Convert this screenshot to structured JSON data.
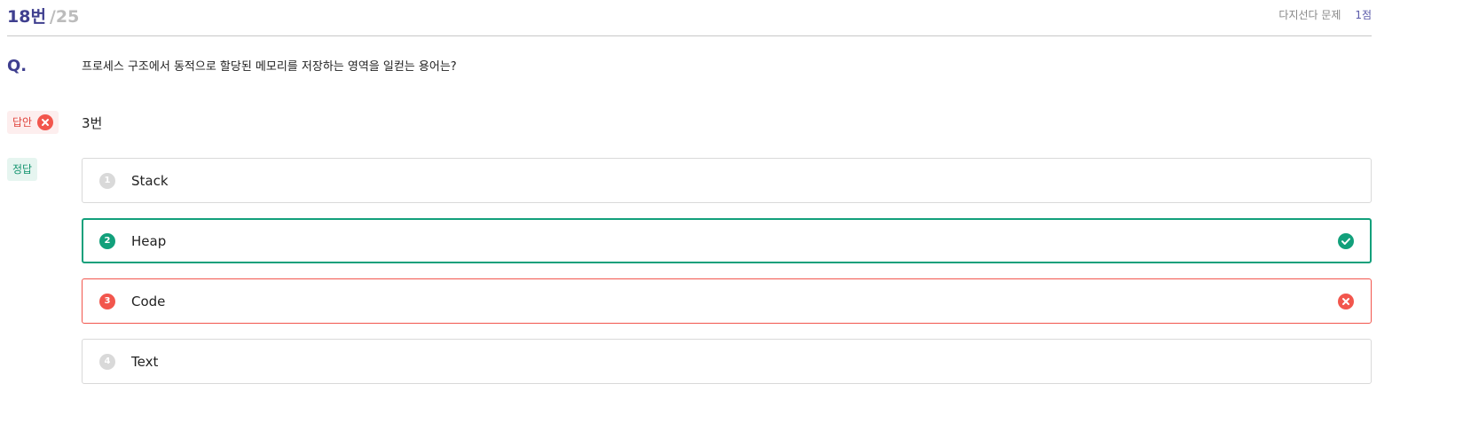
{
  "header": {
    "question_number": "18번",
    "question_total": "/25",
    "question_type": "다지선다 문제",
    "score": "1점"
  },
  "question": {
    "label": "Q.",
    "text": "프로세스 구조에서 동적으로 할당된 메모리를 저장하는 영역을 일컫는 용어는?"
  },
  "answer": {
    "tag_label": "답안",
    "value": "3번",
    "status_icon": "x-circle-icon",
    "status_color": "#f2564d"
  },
  "correct": {
    "tag_label": "정답"
  },
  "options": [
    {
      "number": "1",
      "text": "Stack",
      "state": "neutral"
    },
    {
      "number": "2",
      "text": "Heap",
      "state": "correct",
      "status_icon": "check-circle-icon"
    },
    {
      "number": "3",
      "text": "Code",
      "state": "wrong",
      "status_icon": "x-circle-icon"
    },
    {
      "number": "4",
      "text": "Text",
      "state": "neutral"
    }
  ],
  "colors": {
    "accent": "#3f3f8f",
    "correct": "#12a07b",
    "wrong": "#f2564d",
    "neutral_badge": "#d9d9d9"
  }
}
